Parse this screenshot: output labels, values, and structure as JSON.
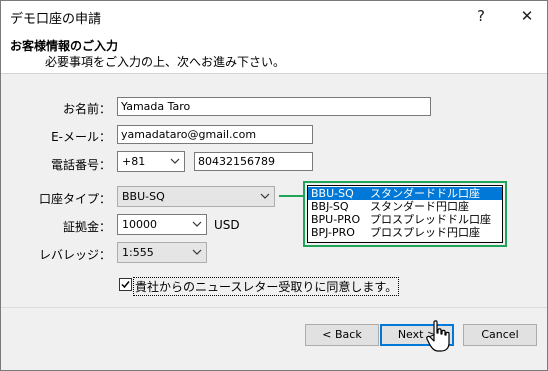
{
  "window": {
    "title": "デモ口座の申請",
    "help_glyph": "?",
    "close_glyph": "✕"
  },
  "header": {
    "title": "お客様情報のご入力",
    "subtitle": "必要事項をご入力の上、次へお進み下さい。"
  },
  "form": {
    "name": {
      "label": "お名前：",
      "value": "Yamada Taro"
    },
    "email": {
      "label": "E-メール：",
      "value": "yamadataro@gmail.com"
    },
    "phone": {
      "label": "電話番号：",
      "country_code": "+81",
      "number": "80432156789"
    },
    "account_type": {
      "label": "口座タイプ：",
      "selected": "BBU-SQ",
      "options": [
        {
          "code": "BBU-SQ",
          "desc": "スタンダードドル口座"
        },
        {
          "code": "BBJ-SQ",
          "desc": "スタンダード円口座"
        },
        {
          "code": "BPU-PRO",
          "desc": "プロスプレッドドル口座"
        },
        {
          "code": "BPJ-PRO",
          "desc": "プロスプレッド円口座"
        }
      ]
    },
    "deposit": {
      "label": "証拠金：",
      "value": "10000",
      "currency": "USD"
    },
    "leverage": {
      "label": "レバレッジ：",
      "value": "1:555"
    },
    "newsletter": {
      "label": "貴社からのニュースレター受取りに同意します。",
      "checked": true
    }
  },
  "buttons": {
    "back": "< Back",
    "next": "Next >",
    "cancel": "Cancel"
  },
  "colors": {
    "highlight": "#1fa55a",
    "selection": "#0078d7"
  }
}
